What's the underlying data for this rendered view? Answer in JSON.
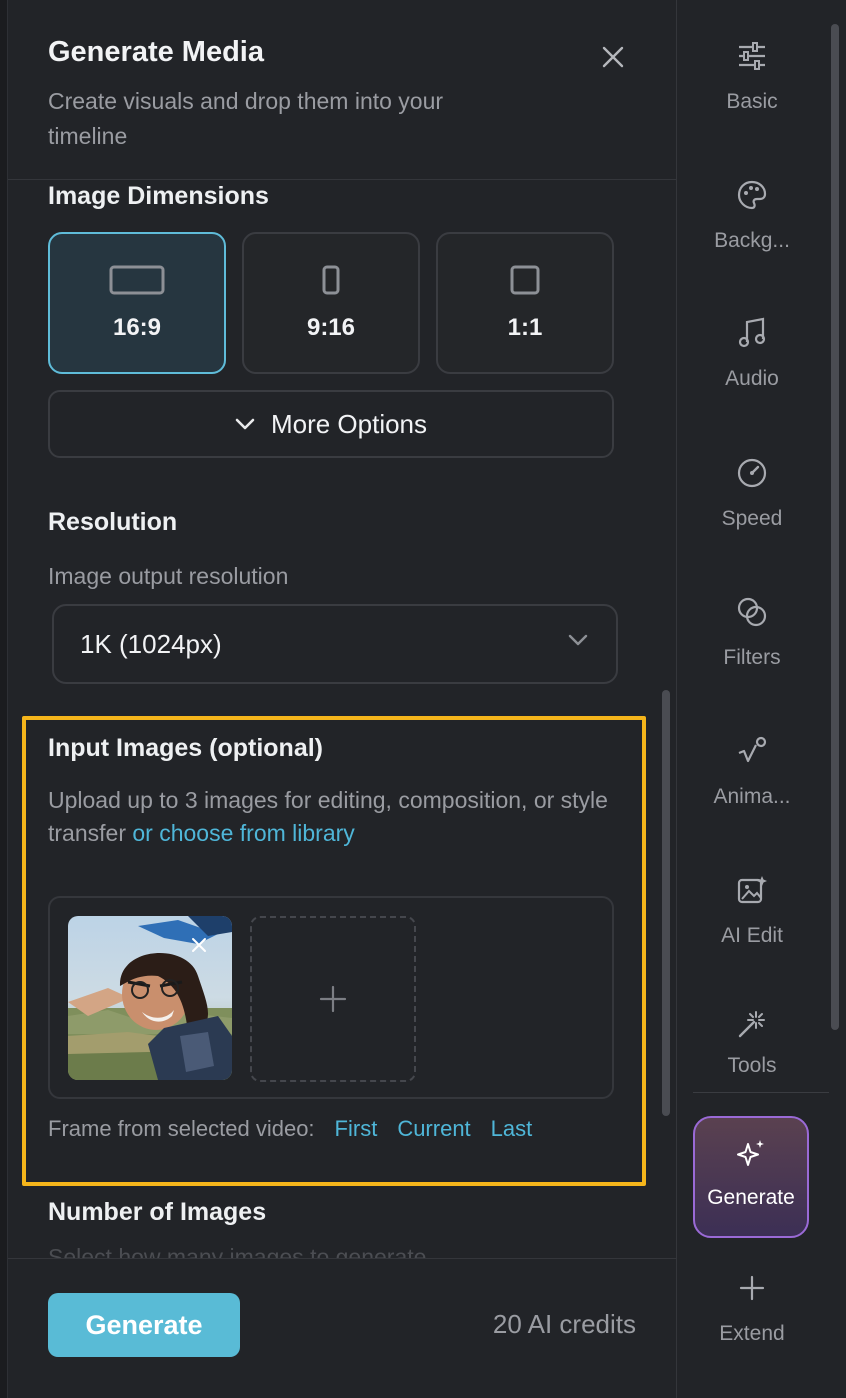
{
  "header": {
    "title": "Generate Media",
    "subtitle": "Create visuals and drop them into your timeline"
  },
  "dimensions": {
    "title": "Image Dimensions",
    "options": [
      {
        "label": "16:9",
        "selected": true
      },
      {
        "label": "9:16",
        "selected": false
      },
      {
        "label": "1:1",
        "selected": false
      }
    ],
    "more_label": "More Options"
  },
  "resolution": {
    "title": "Resolution",
    "label": "Image output resolution",
    "value": "1K (1024px)"
  },
  "input_images": {
    "title": "Input Images (optional)",
    "description": "Upload up to 3 images for editing, composition, or style transfer",
    "library_link": "or choose from library",
    "frame_label": "Frame from selected video:",
    "frame_first": "First",
    "frame_current": "Current",
    "frame_last": "Last"
  },
  "number_of_images": {
    "title": "Number of Images",
    "hint": "Select how many images to generate"
  },
  "footer": {
    "generate_label": "Generate",
    "credits": "20 AI credits"
  },
  "rail": {
    "items": [
      {
        "label": "Basic",
        "icon": "sliders-icon"
      },
      {
        "label": "Backg...",
        "icon": "palette-icon"
      },
      {
        "label": "Audio",
        "icon": "music-note-icon"
      },
      {
        "label": "Speed",
        "icon": "speedometer-icon"
      },
      {
        "label": "Filters",
        "icon": "filters-icon"
      },
      {
        "label": "Anima...",
        "icon": "animation-icon"
      },
      {
        "label": "AI Edit",
        "icon": "ai-image-edit-icon"
      },
      {
        "label": "Tools",
        "icon": "magic-wand-icon"
      }
    ],
    "generate_label": "Generate",
    "extend_label": "Extend"
  },
  "colors": {
    "accent": "#59bbd6",
    "link": "#4fb6d8",
    "highlight": "#f5b51b",
    "panel_bg": "#222428"
  }
}
